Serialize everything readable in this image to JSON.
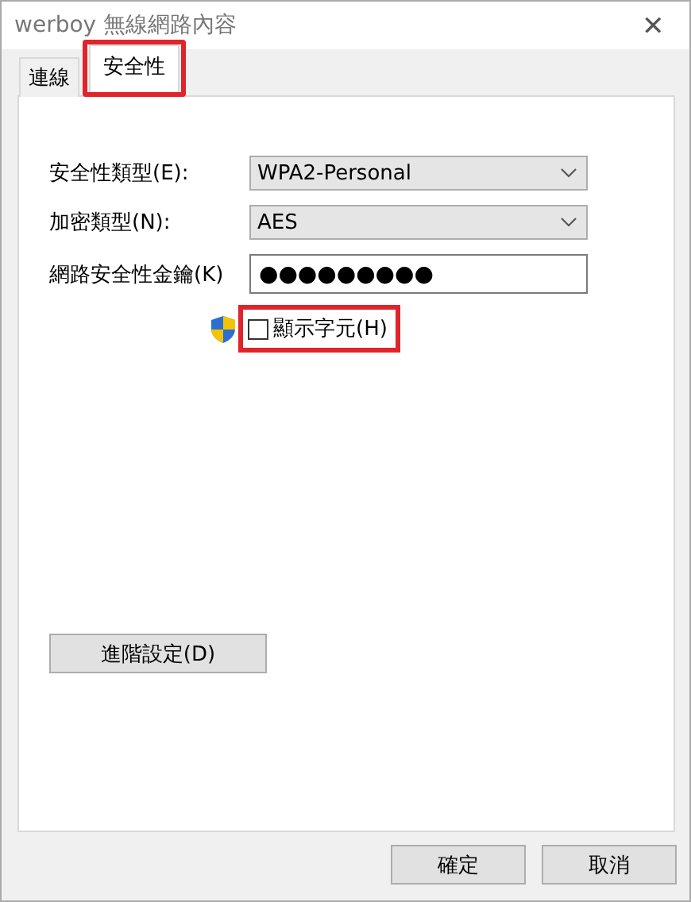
{
  "window": {
    "title": "werboy 無線網路內容",
    "close": "✕"
  },
  "tabs": [
    {
      "label": "連線",
      "selected": false,
      "highlighted": false
    },
    {
      "label": "安全性",
      "selected": true,
      "highlighted": true
    }
  ],
  "fields": [
    {
      "kind": "dropdown",
      "label": "安全性類型(E):",
      "value": "WPA2-Personal"
    },
    {
      "kind": "dropdown",
      "label": "加密類型(N):",
      "value": "AES"
    },
    {
      "kind": "password",
      "label": "網路安全性金鑰(K)",
      "value": "●●●●●●●●●"
    }
  ],
  "show_characters": {
    "label": "顯示字元(H)",
    "checked": false,
    "highlighted": true
  },
  "advanced_button": "進階設定(D)",
  "buttons": [
    "確定",
    "取消"
  ]
}
